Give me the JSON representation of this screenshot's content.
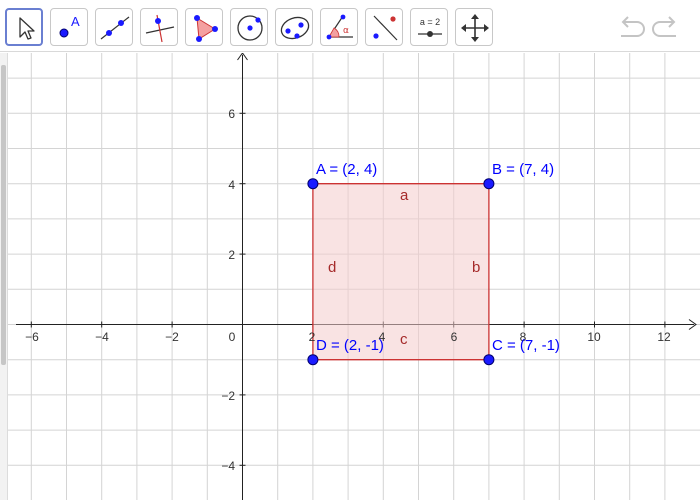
{
  "toolbar": {
    "tools": [
      {
        "name": "move-tool",
        "selected": true
      },
      {
        "name": "point-tool",
        "icon_text": "A"
      },
      {
        "name": "line-tool"
      },
      {
        "name": "perpendicular-line-tool"
      },
      {
        "name": "polygon-tool"
      },
      {
        "name": "circle-center-point-tool"
      },
      {
        "name": "conic-tool"
      },
      {
        "name": "angle-tool",
        "icon_text": "α"
      },
      {
        "name": "reflect-tool"
      },
      {
        "name": "slider-tool",
        "icon_text": "a = 2"
      },
      {
        "name": "move-graphics-view-tool"
      }
    ],
    "undo": "undo-icon",
    "redo": "redo-icon"
  },
  "axes": {
    "x_ticks": [
      "−6",
      "−4",
      "−2",
      "0",
      "2",
      "4",
      "6",
      "10",
      "12"
    ],
    "y_ticks": [
      "6",
      "4",
      "2",
      "−2",
      "−4"
    ],
    "hidden_x_tick": "8"
  },
  "points": [
    {
      "name": "A",
      "x": 2,
      "y": 4,
      "label": "A = (2, 4)"
    },
    {
      "name": "B",
      "x": 7,
      "y": 4,
      "label": "B = (7, 4)"
    },
    {
      "name": "C",
      "x": 7,
      "y": -1,
      "label": "C = (7, -1)"
    },
    {
      "name": "D",
      "x": 2,
      "y": -1,
      "label": "D = (2, -1)"
    }
  ],
  "segments": [
    {
      "name": "a",
      "from": "A",
      "to": "B"
    },
    {
      "name": "b",
      "from": "B",
      "to": "C"
    },
    {
      "name": "c",
      "from": "C",
      "to": "D"
    },
    {
      "name": "d",
      "from": "D",
      "to": "A"
    }
  ],
  "colors": {
    "polygon_fill": "#f4cccc",
    "polygon_stroke": "#cc3333",
    "point_fill": "#1a1aff",
    "point_label": "#0000ff",
    "segment_label": "#a52a2a",
    "grid": "#d4d4d4",
    "axis": "#222222",
    "selected_tool_border": "#6a7fd1"
  }
}
